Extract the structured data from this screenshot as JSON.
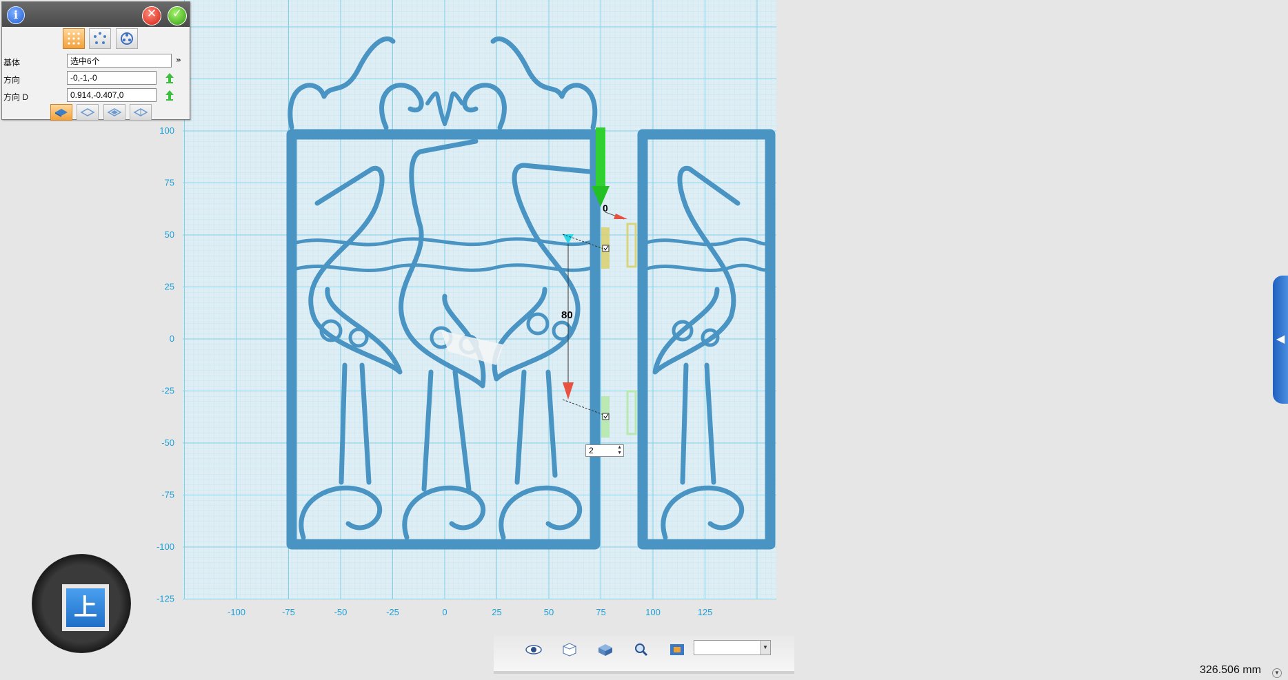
{
  "panel": {
    "info_icon": "info-icon",
    "cancel_icon": "cancel-icon",
    "ok_icon": "confirm-icon",
    "modes": [
      "linear-array-icon",
      "circular-array-icon",
      "curve-array-icon"
    ],
    "fields": {
      "base_label": "基体",
      "base_value": "选中6个",
      "direction_label": "方向",
      "direction_value": "-0,-1,-0",
      "direction_d_label": "方向  D",
      "direction_d_value": "0.914,-0.407,0"
    },
    "array_types": [
      "box-array-icon",
      "diamond-array-icon",
      "rhombus-array-icon",
      "offset-array-icon"
    ]
  },
  "scene": {
    "y_ticks": [
      "100",
      "75",
      "50",
      "25",
      "0",
      "-25",
      "-50",
      "-75",
      "-100",
      "-125"
    ],
    "x_ticks": [
      "-100",
      "-75",
      "-50",
      "-25",
      "0",
      "25",
      "50",
      "75",
      "100",
      "125"
    ],
    "dimension_value": "80",
    "zero_value": "0",
    "count_value": "2",
    "grid_color": "#7fd0e8",
    "model_color": "#4a94c4"
  },
  "view_cube": {
    "face_label": "上"
  },
  "toolbar": {
    "icons": [
      "eye-icon",
      "wireframe-cube-icon",
      "solid-cube-icon",
      "zoom-icon",
      "fit-view-icon"
    ],
    "select_value": ""
  },
  "status": {
    "measure": "326.506 mm"
  },
  "side_panel": {
    "toggle_icon": "chevron-left-icon"
  }
}
